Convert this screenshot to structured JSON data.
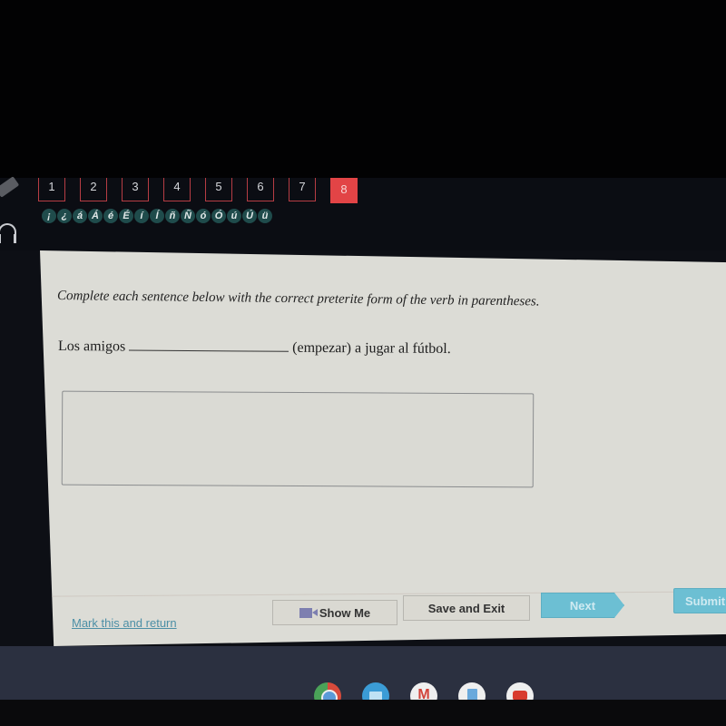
{
  "toolbar": {
    "question_numbers": [
      "1",
      "2",
      "3",
      "4",
      "5",
      "6",
      "7",
      "8"
    ],
    "active_question": "8",
    "accent_characters": [
      "¡",
      "¿",
      "á",
      "Á",
      "é",
      "É",
      "í",
      "Í",
      "ñ",
      "Ñ",
      "ó",
      "Ó",
      "ú",
      "Ú",
      "ü"
    ]
  },
  "question": {
    "instructions": "Complete each sentence below with the correct preterite form of the verb in parentheses.",
    "sentence_before": "Los amigos",
    "sentence_after": "(empezar) a jugar al fútbol.",
    "answer_value": ""
  },
  "footer": {
    "mark_link": "Mark this and return",
    "show_me_label": "Show Me",
    "save_exit_label": "Save and Exit",
    "next_label": "Next",
    "submit_label": "Submit"
  },
  "shelf": {
    "apps": [
      "chrome",
      "files",
      "gmail",
      "docs",
      "youtube"
    ]
  },
  "colors": {
    "active_question": "#e24446",
    "primary_button": "#6cbfd3",
    "link": "#4d8fa6",
    "accent_button": "#1f4b4b"
  }
}
